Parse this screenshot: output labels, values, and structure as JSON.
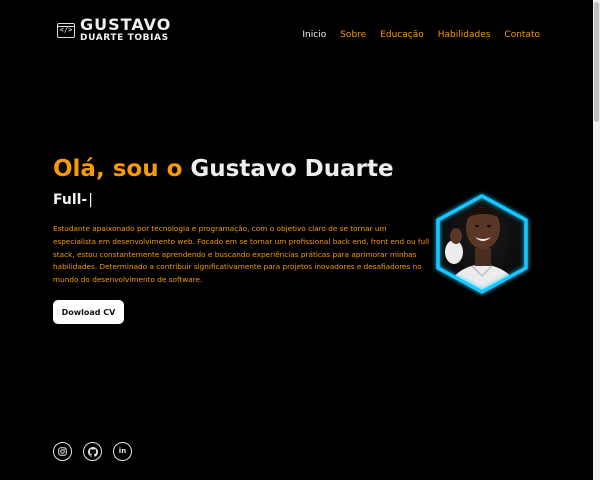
{
  "logo": {
    "line1": "GUSTAVO",
    "line2": "DUARTE TOBIAS",
    "icon": "code-window-icon",
    "icon_glyph": "</>"
  },
  "nav": [
    {
      "label": "Inicio",
      "active": true
    },
    {
      "label": "Sobre"
    },
    {
      "label": "Educação"
    },
    {
      "label": "Habilidades"
    },
    {
      "label": "Contato"
    }
  ],
  "hero": {
    "greeting": "Olá, sou o",
    "name": "Gustavo Duarte",
    "typing_text": "Full-",
    "caret": "|",
    "description": "Estudante apaixonado por tecnologia e programação, com o objetivo claro de se tornar um especialista em desenvolvimento web. Focado em se tornar um profissional back end, front end ou full stack, estou constantemente aprendendo e buscando experiências práticas para aprimorar minhas habilidades. Determinado a contribuir significativamente para projetos inovadores e desafiadores no mundo do desenvolvimento de software.",
    "cv_button": "Dowload CV"
  },
  "social": [
    {
      "name": "instagram-icon"
    },
    {
      "name": "github-icon"
    },
    {
      "name": "linkedin-icon",
      "label": "in"
    }
  ],
  "colors": {
    "accent": "#f59a0a",
    "background": "#000000",
    "hex_glow": "#19c8ff"
  }
}
